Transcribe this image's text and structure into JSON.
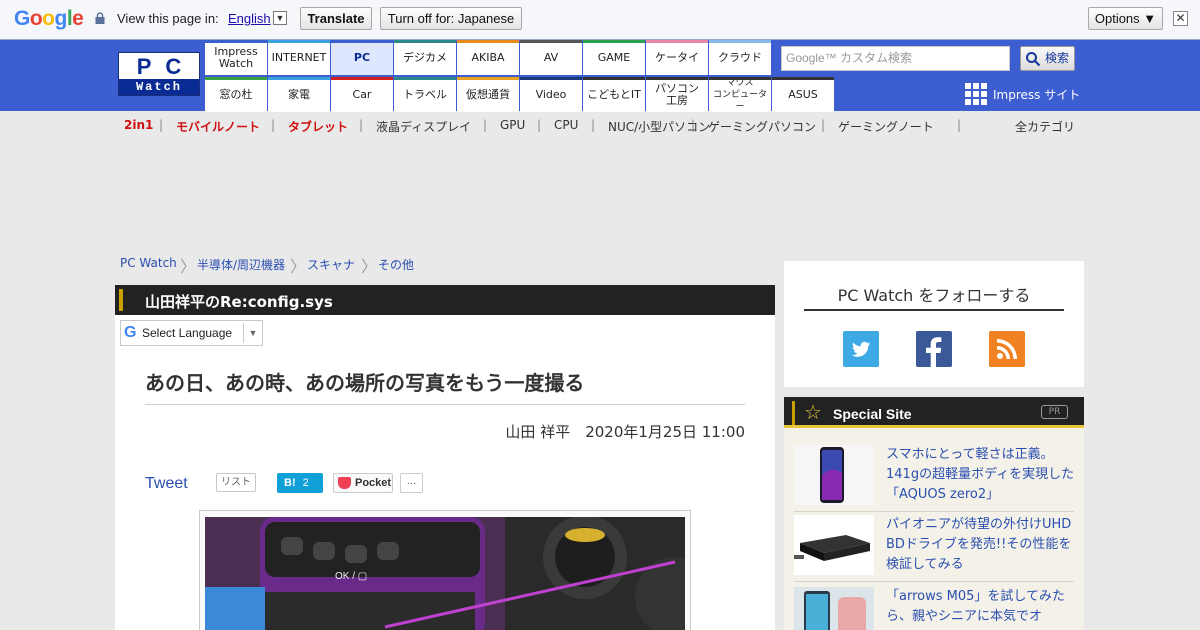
{
  "translate_bar": {
    "brand": "Google",
    "view_text": "View this page in:",
    "language": "English",
    "translate_label": "Translate",
    "turn_off_label": "Turn off for: Japanese",
    "options_label": "Options ▼",
    "close_label": "✕"
  },
  "header": {
    "logo_top": "PC",
    "logo_bottom": "Watch",
    "nav_top": [
      {
        "label": "Impress\nWatch",
        "color": "#3c5fd0"
      },
      {
        "label": "INTERNET",
        "color": "#3aa0e0"
      },
      {
        "label": "PC",
        "color": "#3d5ed1"
      },
      {
        "label": "デジカメ",
        "color": "#2a8a8a"
      },
      {
        "label": "AKIBA",
        "color": "#e88a20"
      },
      {
        "label": "AV",
        "color": "#555555"
      },
      {
        "label": "GAME",
        "color": "#2aa050"
      },
      {
        "label": "ケータイ",
        "color": "#e888a8"
      },
      {
        "label": "クラウド",
        "color": "#88b8e8"
      }
    ],
    "nav_bottom": [
      {
        "label": "窓の杜",
        "color": "#3aa040"
      },
      {
        "label": "家電",
        "color": "#3aa0e0"
      },
      {
        "label": "Car",
        "color": "#d02020"
      },
      {
        "label": "トラベル",
        "color": "#2a8a8a"
      },
      {
        "label": "仮想通貨",
        "color": "#e8a020"
      },
      {
        "label": "Video",
        "color": "#1a3a7a"
      },
      {
        "label": "こどもとIT",
        "color": "#333333"
      },
      {
        "label": "パソコン\n工房",
        "color": "#333333"
      },
      {
        "label": "マウス\nコンピューター",
        "color": "#333333"
      },
      {
        "label": "ASUS",
        "color": "#333333"
      }
    ],
    "search_placeholder": "Google™ カスタム検索",
    "search_button": "検索",
    "impress_site": "Impress サイト"
  },
  "subnav": [
    {
      "label": "2in1",
      "red": true
    },
    {
      "label": "モバイルノート",
      "red": true
    },
    {
      "label": "タブレット",
      "red": true
    },
    {
      "label": "液晶ディスプレイ",
      "red": false
    },
    {
      "label": "GPU",
      "red": false
    },
    {
      "label": "CPU",
      "red": false
    },
    {
      "label": "NUC/小型パソコン",
      "red": false
    },
    {
      "label": "ゲーミングパソコン",
      "red": false
    },
    {
      "label": "ゲーミングノート",
      "red": false
    }
  ],
  "subnav_all": "全カテゴリ",
  "breadcrumb": [
    "PC Watch",
    "半導体/周辺機器",
    "スキャナ",
    "その他"
  ],
  "article": {
    "column": "山田祥平のRe:config.sys",
    "lang_select": "Select Language",
    "title": "あの日、あの時、あの場所の写真をもう一度撮る",
    "byline": "山田 祥平　2020年1月25日 11:00",
    "tweet": "Tweet",
    "list": "リスト",
    "hatena": "B!",
    "hatena_count": "2",
    "pocket": "Pocket",
    "pocket_count": "..."
  },
  "sidebar": {
    "follow_title": "PC Watch をフォローする",
    "special_title": "Special Site",
    "pr": "PR",
    "items": [
      {
        "text": "スマホにとって軽さは正義。141gの超軽量ボディを実現した「AQUOS zero2」"
      },
      {
        "text": "パイオニアが待望の外付けUHD BDドライブを発売!!その性能を検証してみる"
      },
      {
        "text": "「arrows M05」を試してみたら、親やシニアに本気でオ"
      }
    ]
  },
  "colors": {
    "header_blue": "#3d5ed1",
    "link_blue": "#2a4fb0",
    "accent_red": "#d01010",
    "special_gold": "#e8c43a"
  }
}
